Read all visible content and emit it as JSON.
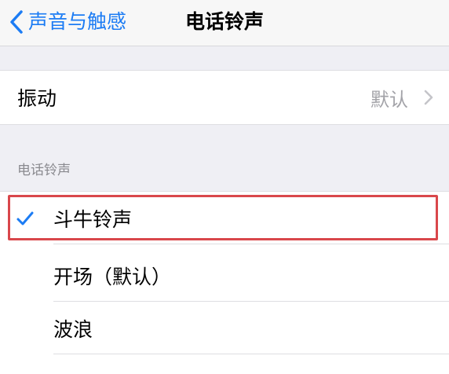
{
  "navbar": {
    "back_label": "声音与触感",
    "title": "电话铃声"
  },
  "vibration": {
    "label": "振动",
    "value": "默认"
  },
  "ringtones": {
    "section_header": "电话铃声",
    "items": [
      {
        "label": "斗牛铃声",
        "selected": true
      },
      {
        "label": "开场（默认）",
        "selected": false
      },
      {
        "label": "波浪",
        "selected": false
      }
    ]
  },
  "colors": {
    "accent": "#1c7cf4",
    "highlight_border": "#d9474b",
    "secondary_text": "#a3a3a8",
    "background": "#efeff4"
  },
  "icons": {
    "back": "chevron-left-icon",
    "disclosure": "chevron-right-icon",
    "selected": "checkmark-icon"
  }
}
